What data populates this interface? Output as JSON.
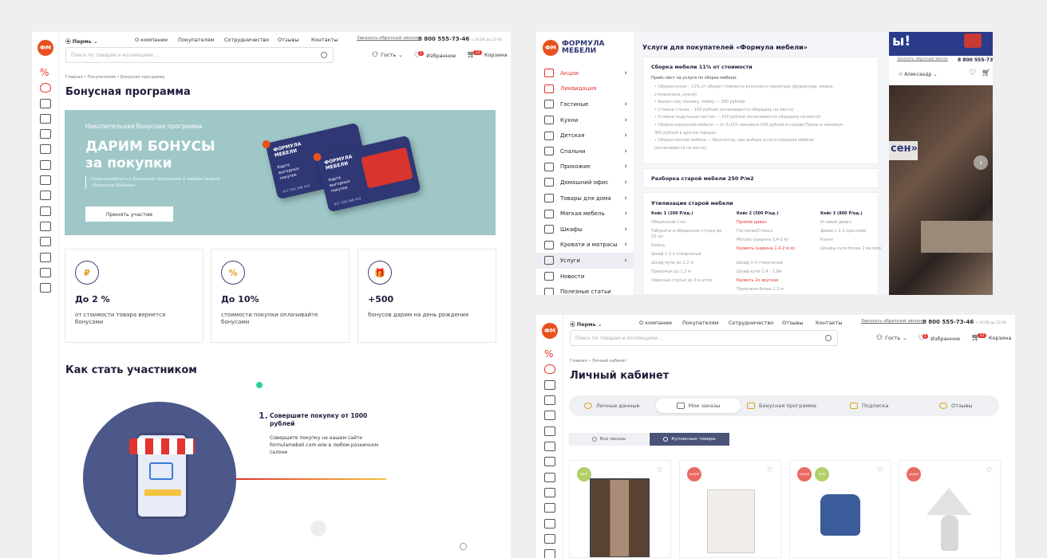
{
  "brand": {
    "logo": "ФМ",
    "name_line1": "ФОРМУЛА",
    "name_line2": "МЕБЕЛИ",
    "color_primary": "#2f3775",
    "color_accent": "#e3342f"
  },
  "header": {
    "city": "Пермь",
    "nav": [
      "О компании",
      "Покупателям",
      "Сотрудничество",
      "Отзывы",
      "Контакты"
    ],
    "callback": "Заказать обратный звонок",
    "phone": "8 800 555-73-46",
    "hours": "с 10:00 до 22:00",
    "search_placeholder": "Поиск по товарам и коллекциям ...",
    "guest": "Гость",
    "favorites": "Избранное",
    "favorites_count": "1",
    "cart": "Корзина",
    "cart_count": "12",
    "user_name": "Александр"
  },
  "bonus_page": {
    "breadcrumbs": "Главная • Покупателям • Бонусная программа",
    "title": "Бонусная программа",
    "banner": {
      "kicker": "Накопительная бонусная программа",
      "headline1": "ДАРИМ БОНУСЫ",
      "headline2": "за покупки",
      "sub": "Подключайтесь к бонусной программе в любом салоне «Формула Мебели»",
      "button": "Принять участие",
      "card_text": "Карта выгодных покупок",
      "card_number": "017 324 168 419"
    },
    "features": [
      {
        "icon": "₽",
        "value": "До 2 %",
        "desc": "от стоимости товара вернется бонусами"
      },
      {
        "icon": "%",
        "value": "До 10%",
        "desc": "стоимости покупки оплачивайте бонусами"
      },
      {
        "icon": "🎁",
        "value": "+500",
        "desc": "бонусов дарим на день рождения"
      }
    ],
    "how_title": "Как стать участником",
    "step": {
      "num": "1.",
      "title": "Совершите покупку от 1000 рублей",
      "desc": "Совершите покупку на нашем сайте formulamebeli.com или в любом розничном салоне"
    }
  },
  "services_page": {
    "title": "Услуги для покупателей «Формула мебели»",
    "menu": [
      {
        "label": "Акции",
        "red": true,
        "arrow": true
      },
      {
        "label": "Ликвидация",
        "red": true,
        "arrow": false
      },
      {
        "label": "Гостиные",
        "arrow": true
      },
      {
        "label": "Кухни",
        "arrow": true
      },
      {
        "label": "Детская",
        "arrow": true
      },
      {
        "label": "Спальни",
        "arrow": true
      },
      {
        "label": "Прихожие",
        "arrow": true
      },
      {
        "label": "Домашний офис",
        "arrow": true
      },
      {
        "label": "Товары для дома",
        "arrow": true
      },
      {
        "label": "Мягкая мебель",
        "arrow": true
      },
      {
        "label": "Шкафы",
        "arrow": true
      },
      {
        "label": "Кровати и матрасы",
        "arrow": true
      },
      {
        "label": "Услуги",
        "arrow": true,
        "active": true
      },
      {
        "label": "Новости",
        "arrow": false
      },
      {
        "label": "Полезные статьи",
        "arrow": false
      }
    ],
    "assembly": {
      "title": "Сборка мебели 11% от стоимости",
      "subtitle": "Прайс-лист на услуги по сборке мебели:",
      "items": [
        "• Сборка кухни – 11% от общей стоимости кухонного гарнитура (фурнитура, мойка,",
        "столешница, кухня)",
        "• Выпил под технику, мойку — 300 рублей",
        "• Стяжка стенок – 100 рублей (оплачивается сборщику на месте)",
        "• Стяжка модульных систем — 150 рублей (оплачивается сборщику на месте)",
        "• Сборка корпусной мебели — от 6-11% минимум 500 рублей в городе Пермь и минимум",
        "300 рублей в других городах",
        "• Сборка мягкой мебели — бесплатно, при выборе услуги подъема мебели",
        "(оплачивается на месте)"
      ]
    },
    "disassembly": "Разборка старой мебели 250 Р/м2",
    "disposal": {
      "title": "Утилизация старой мебели",
      "cols": [
        {
          "head": "Кейс 1 (200 Р/ед.)",
          "rows": [
            {
              "t": "Обеденный стол"
            },
            {
              "t": "Табуреты и обеденные стулья до 10 шт"
            },
            {
              "t": "Комод"
            },
            {
              "t": "Шкаф 1-2 х створчатый"
            },
            {
              "t": "Шкаф-купе до 1,2 м"
            },
            {
              "t": "Прихожая до 1,2 м"
            },
            {
              "t": "Офисные стулья до 3-х штук"
            }
          ]
        },
        {
          "head": "Кейс 2 (500 Р/ед.)",
          "rows": [
            {
              "t": "Прямой диван",
              "red": true
            },
            {
              "t": "Гостиная/Стенка"
            },
            {
              "t": "Матрас (ширина 1,4-2 м)"
            },
            {
              "t": "Кровать (ширина 1,4-2 м м)",
              "red": true
            },
            {
              "t": "Шкаф 3-4 створчатый"
            },
            {
              "t": "Шкаф-купе 1,4 – 1,8м"
            },
            {
              "t": "Кровать 2х ярусная",
              "red": true
            },
            {
              "t": "Прихожая более 1,2 м"
            }
          ]
        },
        {
          "head": "Кейс 3 (800 Р/ед.)",
          "rows": [
            {
              "t": "Угловой диван"
            },
            {
              "t": "Диван с 1-2 креслами"
            },
            {
              "t": "Кухня"
            },
            {
              "t": "Шкафы купе более 2 метров"
            }
          ]
        }
      ]
    },
    "promo_top": "ы!",
    "promo_text": "сен»"
  },
  "account_page": {
    "breadcrumbs": "Главная • Личный кабинет",
    "title": "Личный кабинет",
    "tabs": [
      "Личные данные",
      "Мои заказы",
      "Бонусная программа",
      "Подписка",
      "Отзывы"
    ],
    "toggle_all": "Все заказы",
    "toggle_bought": "Купленные товары",
    "badges": [
      [
        "NEW"
      ],
      [
        "АКЦИЯ"
      ],
      [
        "АКЦИЯ",
        "NEW"
      ],
      [
        "АКЦИЯ"
      ]
    ]
  }
}
